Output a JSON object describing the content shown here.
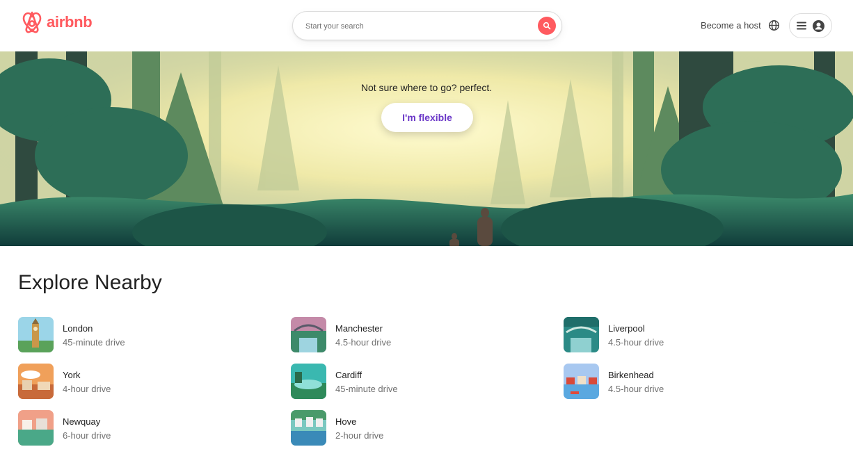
{
  "header": {
    "logo_text": "airbnb",
    "search_placeholder": "Start your search",
    "become_host": "Become a host",
    "brand_color": "#FF5A5F"
  },
  "hero": {
    "tagline": "Not sure where to go? perfect.",
    "cta_label": "I'm flexible",
    "cta_color": "#6B38C8"
  },
  "explore": {
    "title": "Explore Nearby",
    "items": [
      {
        "city": "London",
        "drive": "45-minute drive"
      },
      {
        "city": "Manchester",
        "drive": "4.5-hour drive"
      },
      {
        "city": "Liverpool",
        "drive": "4.5-hour drive"
      },
      {
        "city": "York",
        "drive": "4-hour drive"
      },
      {
        "city": "Cardiff",
        "drive": "45-minute drive"
      },
      {
        "city": "Birkenhead",
        "drive": "4.5-hour drive"
      },
      {
        "city": "Newquay",
        "drive": "6-hour drive"
      },
      {
        "city": "Hove",
        "drive": "2-hour drive"
      }
    ]
  }
}
